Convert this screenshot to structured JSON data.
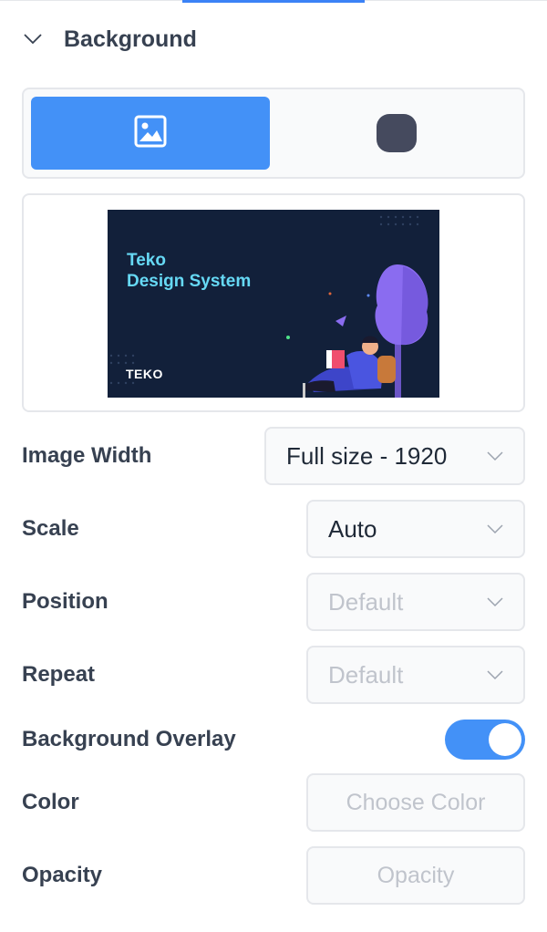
{
  "section": {
    "title": "Background",
    "expanded": true
  },
  "bg_type_tabs": [
    {
      "icon": "image-icon",
      "active": true
    },
    {
      "icon": "color-icon",
      "active": false,
      "swatch": "#454a5e"
    }
  ],
  "preview": {
    "title_line1": "Teko",
    "title_line2": "Design System",
    "logo_text": "TEKO"
  },
  "fields": {
    "image_width": {
      "label": "Image Width",
      "value": "Full size - 1920"
    },
    "scale": {
      "label": "Scale",
      "value": "Auto"
    },
    "position": {
      "label": "Position",
      "placeholder": "Default"
    },
    "repeat": {
      "label": "Repeat",
      "placeholder": "Default"
    },
    "overlay": {
      "label": "Background Overlay",
      "enabled": true
    },
    "color": {
      "label": "Color",
      "placeholder": "Choose Color"
    },
    "opacity": {
      "label": "Opacity",
      "placeholder": "Opacity"
    }
  },
  "colors": {
    "accent": "#4391f7",
    "border": "#e5e7eb",
    "text": "#374151"
  }
}
